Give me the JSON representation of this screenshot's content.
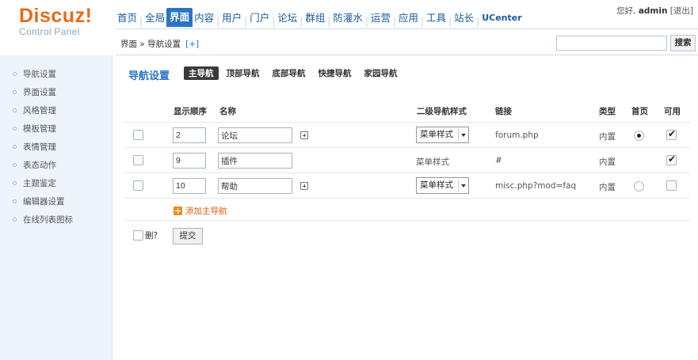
{
  "brand": {
    "logo": "Discuz!",
    "subtitle": "Control Panel"
  },
  "topnav": {
    "items": [
      "首页",
      "全局",
      "界面",
      "内容",
      "用户",
      "门户",
      "论坛",
      "群组",
      "防灌水",
      "运营",
      "应用",
      "工具",
      "站长",
      "UCenter"
    ],
    "active": "界面"
  },
  "user": {
    "greeting": "您好,",
    "name": "admin",
    "logout": "[退出]"
  },
  "breadcrumb": {
    "text": "界面 » 导航设置",
    "plus": "[+]"
  },
  "search": {
    "value": "",
    "button": "搜索"
  },
  "sidebar": {
    "items": [
      {
        "label": "导航设置"
      },
      {
        "label": "界面设置"
      },
      {
        "label": "风格管理"
      },
      {
        "label": "模板管理"
      },
      {
        "label": "表情管理"
      },
      {
        "label": "表态动作"
      },
      {
        "label": "主题鉴定"
      },
      {
        "label": "编辑器设置"
      },
      {
        "label": "在线列表图标"
      }
    ]
  },
  "main": {
    "title": "导航设置",
    "tabs": [
      {
        "label": "主导航",
        "active": true
      },
      {
        "label": "顶部导航",
        "active": false
      },
      {
        "label": "底部导航",
        "active": false
      },
      {
        "label": "快捷导航",
        "active": false
      },
      {
        "label": "家园导航",
        "active": false
      }
    ],
    "headers": {
      "order": "显示顺序",
      "name": "名称",
      "subnav_style": "二级导航样式",
      "link": "链接",
      "type": "类型",
      "home": "首页",
      "available": "可用"
    },
    "rows": [
      {
        "order": "2",
        "name": "论坛",
        "style": "菜单样式",
        "style_select": true,
        "link": "forum.php",
        "type": "内置",
        "home": true,
        "available": true,
        "has_sub_icon": true
      },
      {
        "order": "9",
        "name": "插件",
        "style": "菜单样式",
        "style_select": false,
        "link": "#",
        "type": "内置",
        "home": null,
        "available": true,
        "has_sub_icon": false
      },
      {
        "order": "10",
        "name": "帮助",
        "style": "菜单样式",
        "style_select": true,
        "link": "misc.php?mod=faq",
        "type": "内置",
        "home": false,
        "available": false,
        "has_sub_icon": true
      }
    ],
    "add_link": "添加主导航",
    "delete_label": "删?",
    "submit": "提交"
  }
}
